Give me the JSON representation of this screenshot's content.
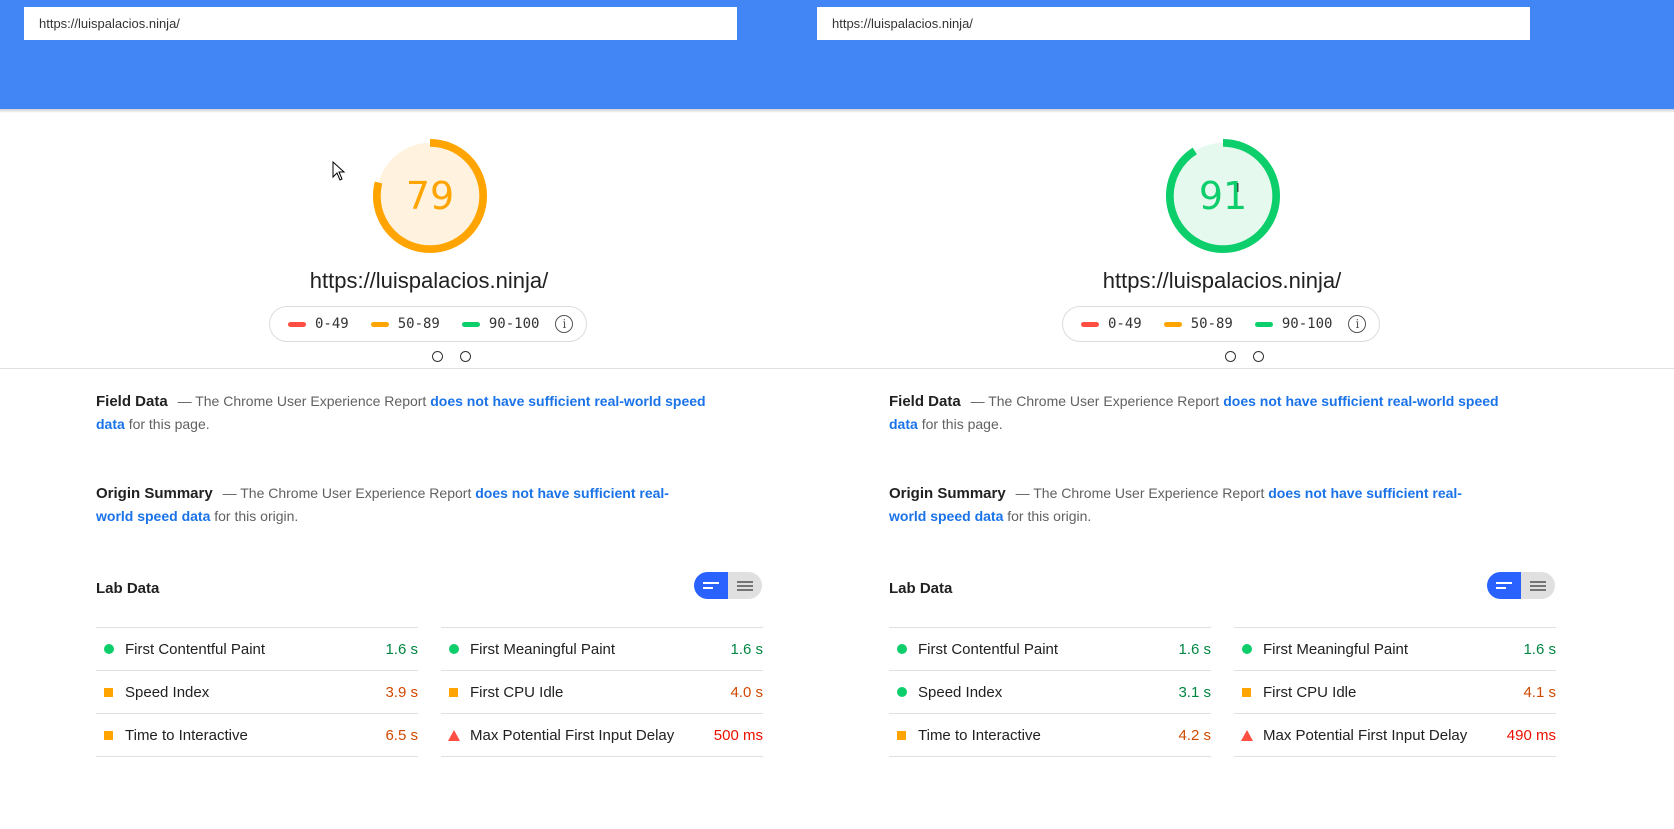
{
  "left": {
    "url_value": "https://luispalacios.ninja/",
    "score": "79",
    "score_fraction": 0.79,
    "score_color": "#ffa400",
    "score_bg": "#fff3e0",
    "page_url": "https://luispalacios.ninja/",
    "legend": [
      "0-49",
      "50-89",
      "90-100"
    ],
    "field": {
      "title": "Field Data",
      "dash": "—",
      "text": "The Chrome User Experience Report",
      "link": "does not have sufficient real-world speed data",
      "tail": "for this page."
    },
    "origin": {
      "title": "Origin Summary",
      "dash": "—",
      "text": "The Chrome User Experience Report",
      "link": "does not have sufficient real-world speed data",
      "tail": "for this origin."
    },
    "lab_title": "Lab Data",
    "metrics_left": [
      {
        "label": "First Contentful Paint",
        "value": "1.6 s",
        "status": "pass"
      },
      {
        "label": "Speed Index",
        "value": "3.9 s",
        "status": "average"
      },
      {
        "label": "Time to Interactive",
        "value": "6.5 s",
        "status": "average"
      }
    ],
    "metrics_right": [
      {
        "label": "First Meaningful Paint",
        "value": "1.6 s",
        "status": "pass"
      },
      {
        "label": "First CPU Idle",
        "value": "4.0 s",
        "status": "average"
      },
      {
        "label": "Max Potential First Input Delay",
        "value": "500 ms",
        "status": "fail"
      }
    ]
  },
  "right": {
    "url_value": "https://luispalacios.ninja/",
    "score": "91",
    "score_fraction": 0.91,
    "score_color": "#0cce6b",
    "score_bg": "#e6f9ee",
    "page_url": "https://luispalacios.ninja/",
    "legend": [
      "0-49",
      "50-89",
      "90-100"
    ],
    "field": {
      "title": "Field Data",
      "dash": "—",
      "text": "The Chrome User Experience Report",
      "link": "does not have sufficient real-world speed data",
      "tail": "for this page."
    },
    "origin": {
      "title": "Origin Summary",
      "dash": "—",
      "text": "The Chrome User Experience Report",
      "link": "does not have sufficient real-world speed data",
      "tail": "for this origin."
    },
    "lab_title": "Lab Data",
    "metrics_left": [
      {
        "label": "First Contentful Paint",
        "value": "1.6 s",
        "status": "pass"
      },
      {
        "label": "Speed Index",
        "value": "3.1 s",
        "status": "pass"
      },
      {
        "label": "Time to Interactive",
        "value": "4.2 s",
        "status": "average"
      }
    ],
    "metrics_right": [
      {
        "label": "First Meaningful Paint",
        "value": "1.6 s",
        "status": "pass"
      },
      {
        "label": "First CPU Idle",
        "value": "4.1 s",
        "status": "average"
      },
      {
        "label": "Max Potential First Input Delay",
        "value": "490 ms",
        "status": "fail"
      }
    ]
  },
  "colors": {
    "header": "#4285f4",
    "fail": "#ff4e42",
    "average": "#ffa400",
    "pass": "#0cce6b",
    "link": "#1a73e8",
    "toggle_active": "#2962ff"
  },
  "icons": {
    "legend_info": "info-icon",
    "toggle_on": "summary-view-icon",
    "toggle_off": "list-view-icon",
    "pointer": "mouse-pointer-icon",
    "text_cursor": "text-cursor-icon"
  }
}
